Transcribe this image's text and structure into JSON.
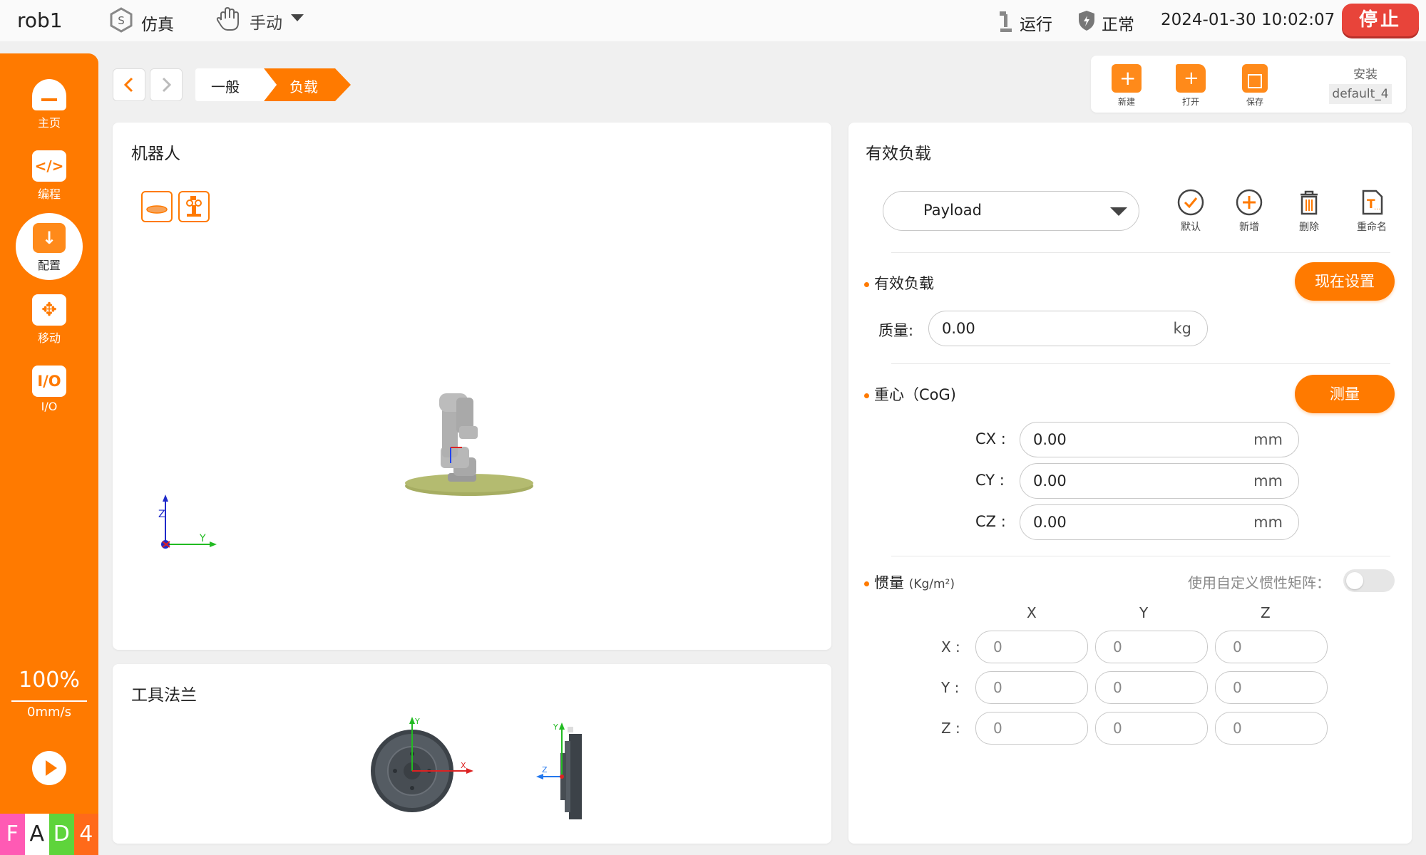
{
  "topbar": {
    "robot_name": "rob1",
    "mode_sim": "仿真",
    "mode_manual": "手动",
    "run_status": "运行",
    "safety_status": "正常",
    "datetime": "2024-01-30 10:02:07",
    "stop_label": "停止"
  },
  "sidebar": {
    "items": [
      {
        "label": "主页",
        "icon": "home-icon"
      },
      {
        "label": "编程",
        "icon": "code-icon"
      },
      {
        "label": "配置",
        "icon": "config-icon"
      },
      {
        "label": "移动",
        "icon": "move-icon"
      },
      {
        "label": "I/O",
        "icon": "io-icon"
      }
    ],
    "speed_percent": "100%",
    "speed_value": "0mm/s",
    "brand_letters": [
      "F",
      "A",
      "D",
      "4"
    ]
  },
  "breadcrumb": {
    "items": [
      "一般",
      "负载"
    ]
  },
  "file_toolbar": {
    "new_label": "新建",
    "open_label": "打开",
    "save_label": "保存",
    "install_title": "安装",
    "install_name": "default_4"
  },
  "robot_panel": {
    "title": "机器人",
    "axis_z": "Z",
    "axis_y": "Y"
  },
  "flange_panel": {
    "title": "工具法兰",
    "axis_x": "X",
    "axis_y": "Y",
    "axis_z": "Z"
  },
  "payload_panel": {
    "title": "有效负载",
    "selected_payload": "Payload",
    "actions": {
      "default": "默认",
      "add": "新增",
      "delete": "删除",
      "rename": "重命名"
    },
    "payload_section": {
      "title": "有效负载",
      "set_now_label": "现在设置",
      "mass_label": "质量:",
      "mass_value": "0.00",
      "mass_unit": "kg"
    },
    "cog_section": {
      "title": "重心（CoG)",
      "measure_label": "测量",
      "rows": [
        {
          "label": "CX :",
          "value": "0.00",
          "unit": "mm"
        },
        {
          "label": "CY :",
          "value": "0.00",
          "unit": "mm"
        },
        {
          "label": "CZ :",
          "value": "0.00",
          "unit": "mm"
        }
      ]
    },
    "inertia_section": {
      "title": "惯量",
      "unit": "(Kg/m²)",
      "custom_matrix_label": "使用自定义惯性矩阵：",
      "custom_matrix_enabled": false,
      "col_headers": [
        "X",
        "Y",
        "Z"
      ],
      "rows": [
        {
          "label": "X :",
          "values": [
            "0",
            "0",
            "0"
          ]
        },
        {
          "label": "Y :",
          "values": [
            "0",
            "0",
            "0"
          ]
        },
        {
          "label": "Z :",
          "values": [
            "0",
            "0",
            "0"
          ]
        }
      ]
    }
  },
  "colors": {
    "accent": "#ff7a00",
    "stop_red": "#e8443a"
  }
}
